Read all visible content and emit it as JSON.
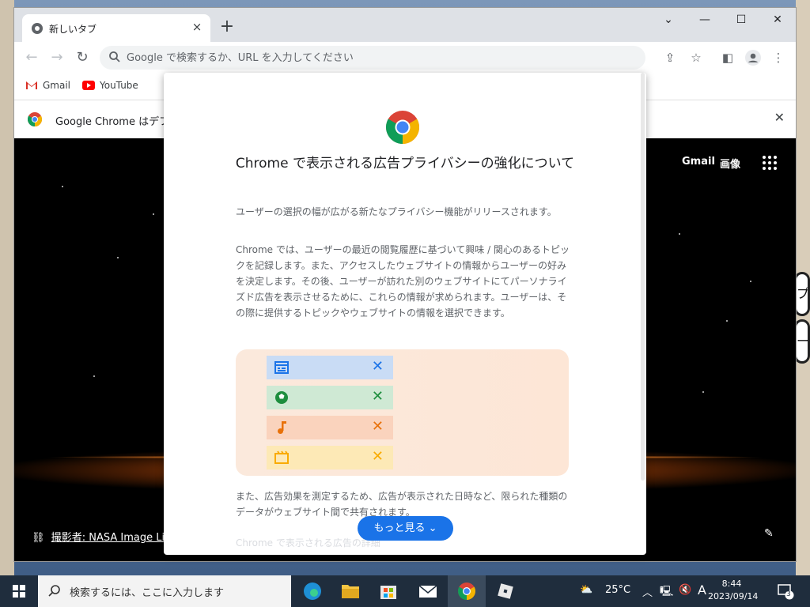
{
  "browser": {
    "tab_title": "新しいタブ",
    "tab_close": "×",
    "new_tab": "+",
    "window_controls": [
      "⌄",
      "—",
      "☐",
      "✕"
    ],
    "omnibox_placeholder": "Google で検索するか、URL を入力してください",
    "bookmarks": [
      "Gmail",
      "YouTube"
    ],
    "infobar_text": "Google Chrome はデフォル",
    "infobar_close": "✕"
  },
  "newtab_page": {
    "gmail_link": "Gmail",
    "images_link": "画像",
    "credit_label": "撮影者: NASA Image Li"
  },
  "dialog": {
    "title": "Chrome で表示される広告プライバシーの強化について",
    "para1": "ユーザーの選択の幅が広がる新たなプライバシー機能がリリースされます。",
    "para2": "Chrome では、ユーザーの最近の閲覧履歴に基づいて興味 / 関心のあるトピックを記録します。また、アクセスしたウェブサイトの情報からユーザーの好みを決定します。その後、ユーザーが訪れた別のウェブサイトにてパーソナライズド広告を表示させるために、これらの情報が求められます。ユーザーは、その際に提供するトピックやウェブサイトの情報を選択できます。",
    "para3": "また、広告効果を測定するため、広告が表示された日時など、限られた種類のデータがウェブサイト間で共有されます。",
    "more_button": "もっと見る",
    "faded_text": "Chrome で表示される広告の詳細",
    "illustration_rows": [
      {
        "icon": "calendar-icon",
        "bg": "#c9dcf5",
        "color": "#1a73e8"
      },
      {
        "icon": "soccer-ball-icon",
        "bg": "#cfe9d4",
        "color": "#1e8e3e"
      },
      {
        "icon": "music-note-icon",
        "bg": "#fad3bd",
        "color": "#e8710a"
      },
      {
        "icon": "film-icon",
        "bg": "#fde9b6",
        "color": "#f9ab00"
      }
    ]
  },
  "taskbar": {
    "search_placeholder": "検索するには、ここに入力します",
    "weather": "25°C",
    "ime": "A",
    "time": "8:44",
    "date": "2023/09/14",
    "notification_count": "3"
  },
  "side_buttons": [
    "プ",
    "ー"
  ],
  "colors": {
    "accent": "#1a73e8",
    "taskbar": "#1f2d3d"
  }
}
